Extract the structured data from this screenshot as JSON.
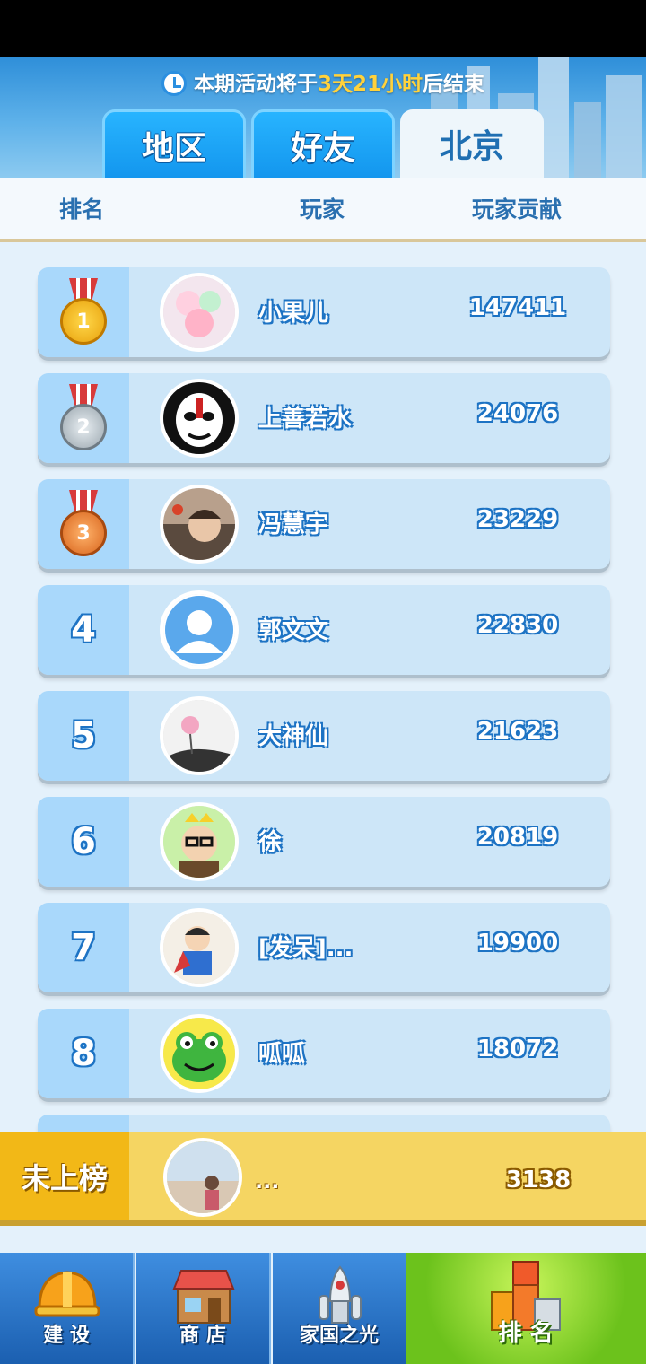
{
  "header": {
    "countdown_prefix": "本期活动将于",
    "countdown_highlight": "3天21小时",
    "countdown_suffix": "后结束",
    "tabs": [
      {
        "label": "地区",
        "active": false
      },
      {
        "label": "好友",
        "active": false
      },
      {
        "label": "北京",
        "active": true
      }
    ]
  },
  "columns": {
    "rank": "排名",
    "player": "玩家",
    "contribution": "玩家贡献"
  },
  "rows": [
    {
      "rank": "1",
      "name": "小果儿",
      "score": "147411"
    },
    {
      "rank": "2",
      "name": "上善若水",
      "score": "24076"
    },
    {
      "rank": "3",
      "name": "冯慧宇",
      "score": "23229"
    },
    {
      "rank": "4",
      "name": "郭文文",
      "score": "22830"
    },
    {
      "rank": "5",
      "name": "大神仙",
      "score": "21623"
    },
    {
      "rank": "6",
      "name": "徐",
      "score": "20819"
    },
    {
      "rank": "7",
      "name": "[发呆]...",
      "score": "19900"
    },
    {
      "rank": "8",
      "name": "呱呱",
      "score": "18072"
    }
  ],
  "my_rank": {
    "label": "未上榜",
    "name": "...",
    "score": "3138"
  },
  "nav": [
    {
      "label": "建 设",
      "icon": "hardhat-icon",
      "active": false
    },
    {
      "label": "商 店",
      "icon": "shop-icon",
      "active": false
    },
    {
      "label": "家国之光",
      "icon": "rocket-icon",
      "active": false
    },
    {
      "label": "排 名",
      "icon": "podium-icon",
      "active": true
    }
  ],
  "colors": {
    "accent_blue": "#1d73c4",
    "active_nav": "#6cc21c",
    "my_bar": "#f5d562"
  }
}
